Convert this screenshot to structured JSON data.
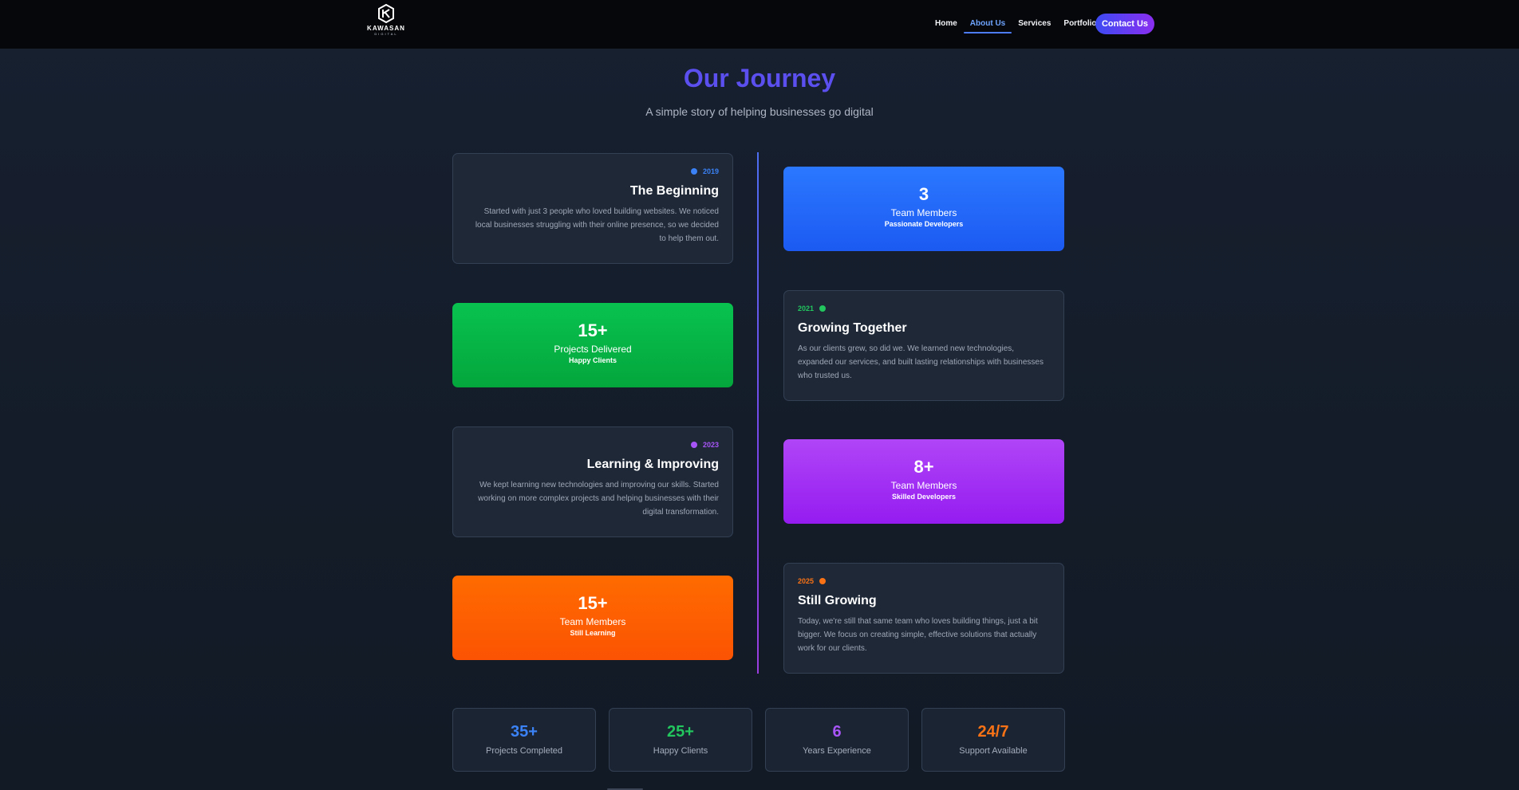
{
  "nav": {
    "logo_name": "KAWASAN",
    "logo_sub": "DIGITAL",
    "links": [
      "Home",
      "About Us",
      "Services",
      "Portfolio"
    ],
    "active_link": "About Us",
    "contact": "Contact Us"
  },
  "hero": {
    "title": "Our Journey",
    "subtitle": "A simple story of helping businesses go digital"
  },
  "timeline": [
    {
      "year": "2019",
      "title": "The Beginning",
      "text": "Started with just 3 people who loved building websites. We noticed local businesses struggling with their online presence, so we decided to help them out.",
      "color": "#3b82f6"
    },
    {
      "year": "2021",
      "title": "Growing Together",
      "text": "As our clients grew, so did we. We learned new technologies, expanded our services, and built lasting relationships with businesses who trusted us.",
      "color": "#22c55e"
    },
    {
      "year": "2023",
      "title": "Learning & Improving",
      "text": "We kept learning new technologies and improving our skills. Started working on more complex projects and helping businesses with their digital transformation.",
      "color": "#a855f7"
    },
    {
      "year": "2025",
      "title": "Still Growing",
      "text": "Today, we're still that same team who loves building things, just a bit bigger. We focus on creating simple, effective solutions that actually work for our clients.",
      "color": "#f97316"
    }
  ],
  "stats": [
    {
      "value": "3",
      "label": "Team Members",
      "sub": "Passionate Developers"
    },
    {
      "value": "15+",
      "label": "Projects Delivered",
      "sub": "Happy Clients"
    },
    {
      "value": "8+",
      "label": "Team Members",
      "sub": "Skilled Developers"
    },
    {
      "value": "15+",
      "label": "Team Members",
      "sub": "Still Learning"
    }
  ],
  "summary": [
    {
      "value": "35+",
      "label": "Projects Completed",
      "color": "#3b82f6"
    },
    {
      "value": "25+",
      "label": "Happy Clients",
      "color": "#22c55e"
    },
    {
      "value": "6",
      "label": "Years Experience",
      "color": "#a855f7"
    },
    {
      "value": "24/7",
      "label": "Support Available",
      "color": "#f97316"
    }
  ]
}
